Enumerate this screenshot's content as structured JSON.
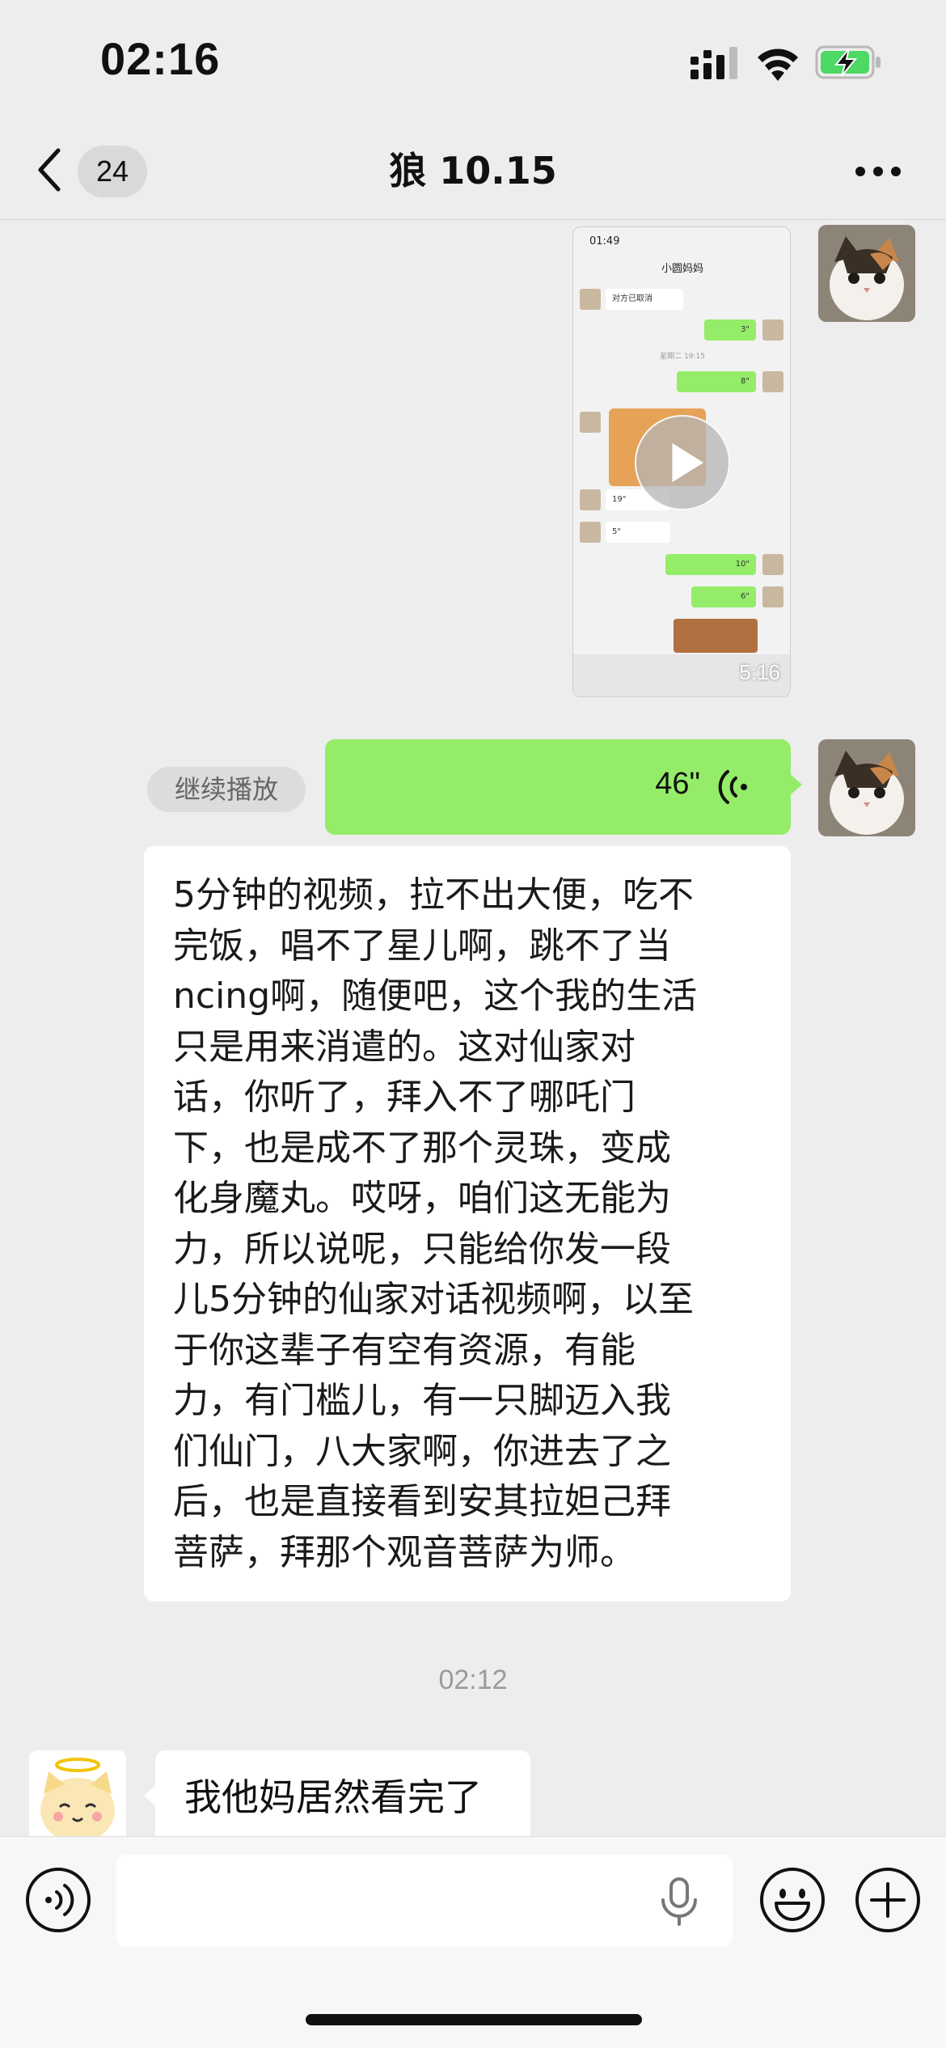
{
  "status_bar": {
    "time": "02:16"
  },
  "nav": {
    "unread_count": "24",
    "title": "狼 10.15"
  },
  "video_message": {
    "duration": "5:16",
    "preview": {
      "status_time": "01:49",
      "title": "小圆妈妈",
      "cancelled_text": "对方已取消",
      "date_label": "星期二 19:15",
      "rows": [
        "3\"",
        "8\"",
        "19\"",
        "5\"",
        "10\"",
        "6\""
      ]
    }
  },
  "voice_message": {
    "continue_label": "继续播放",
    "duration": "46\""
  },
  "transcript_lines": [
    "5分钟的视频，拉不出大便，吃不",
    "完饭，唱不了星儿啊，跳不了当",
    "ncing啊，随便吧，这个我的生活",
    "只是用来消遣的。这对仙家对",
    "话，你听了，拜入不了哪吒门",
    "下，也是成不了那个灵珠，变成",
    "化身魔丸。哎呀，咱们这无能为",
    "力，所以说呢，只能给你发一段",
    "儿5分钟的仙家对话视频啊，以至",
    "于你这辈子有空有资源，有能",
    "力，有门槛儿，有一只脚迈入我",
    "们仙门，八大家啊，你进去了之",
    "后，也是直接看到安其拉妲己拜",
    "菩萨，拜那个观音菩萨为师。"
  ],
  "timestamp": "02:12",
  "received_message": {
    "text": "我他妈居然看完了"
  },
  "colors": {
    "bubble_green": "#95ec69",
    "background": "#ededed",
    "battery_green": "#4cd964"
  }
}
